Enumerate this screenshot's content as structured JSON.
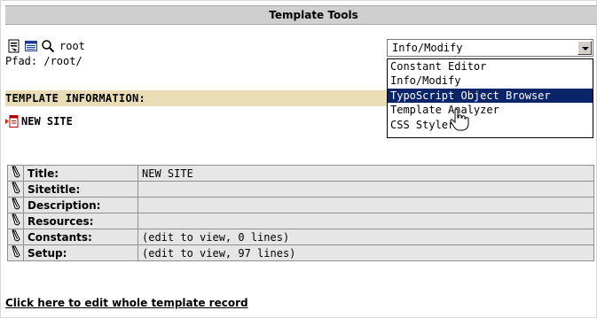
{
  "window": {
    "title": "Template Tools"
  },
  "toolbar": {
    "root_label": "root"
  },
  "path": {
    "text": "Pfad: /root/"
  },
  "module_select": {
    "selected": "Info/Modify",
    "options": [
      "Constant Editor",
      "Info/Modify",
      "TypoScript Object Browser",
      "Template Analyzer",
      "CSS Styler"
    ],
    "highlighted_index": 2
  },
  "template_info": {
    "heading": "TEMPLATE INFORMATION:",
    "site_name": "NEW SITE"
  },
  "table": {
    "rows": [
      {
        "label": "Title:",
        "value": "NEW SITE"
      },
      {
        "label": "Sitetitle:",
        "value": ""
      },
      {
        "label": "Description:",
        "value": ""
      },
      {
        "label": "Resources:",
        "value": ""
      },
      {
        "label": "Constants:",
        "value": "(edit to view, 0 lines)"
      },
      {
        "label": "Setup:",
        "value": "(edit to view, 97 lines)"
      }
    ]
  },
  "edit_link": {
    "label": "Click here to edit whole template record"
  },
  "colors": {
    "selection": "#0a246a",
    "info_bar": "#e8ddb5",
    "title_bar": "#cfcfcf"
  }
}
